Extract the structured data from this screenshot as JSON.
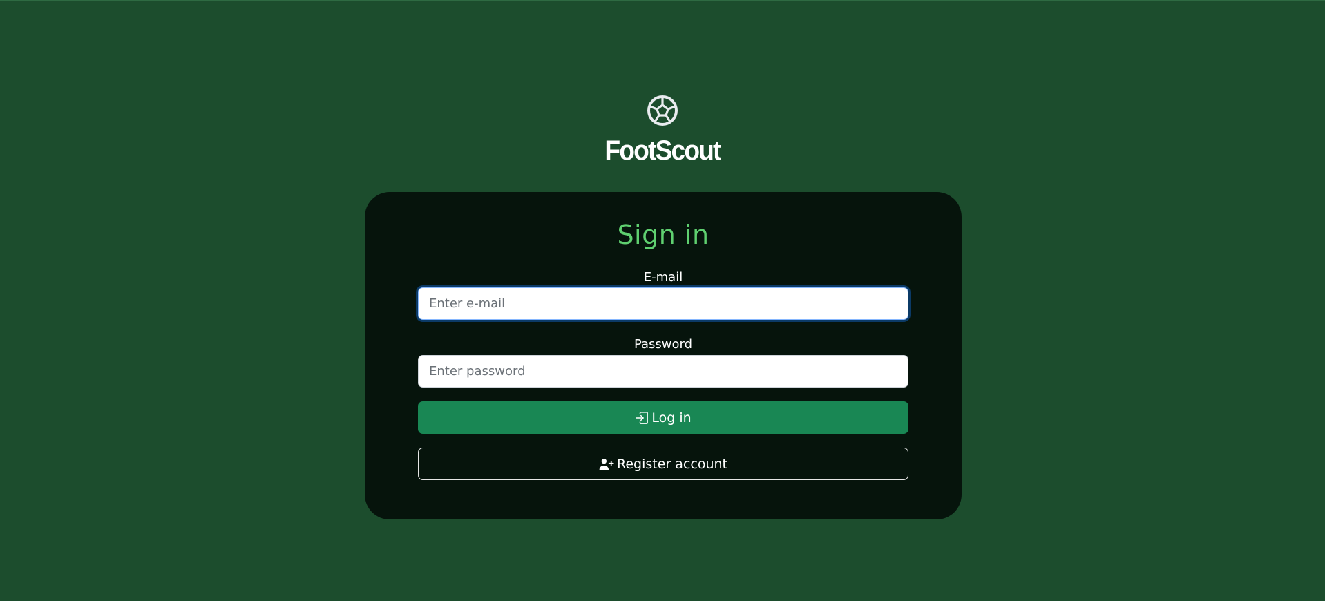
{
  "brand": {
    "name": "FootScout",
    "icon": "soccer-ball-icon"
  },
  "signin": {
    "title": "Sign in",
    "email_label": "E-mail",
    "email_placeholder": "Enter e-mail",
    "email_value": "",
    "password_label": "Password",
    "password_placeholder": "Enter password",
    "password_value": "",
    "login_label": "Log in",
    "login_icon": "box-arrow-in-right-icon",
    "register_label": "Register account",
    "register_icon": "person-plus-icon"
  },
  "colors": {
    "background": "#1c4d2d",
    "card": "#06140c",
    "title": "#5fd070",
    "primary_button": "#198754"
  }
}
